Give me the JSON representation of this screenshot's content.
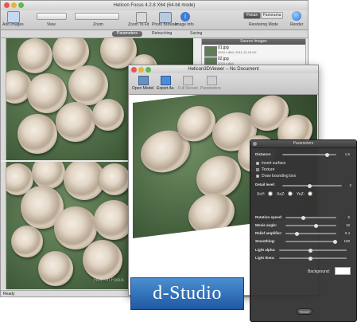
{
  "helicon_focus": {
    "title": "Helicon Focus 4.2.8  X64 (64-bit mode)",
    "toolbar": {
      "add_images": "Add Images",
      "view": "View",
      "zoom": "Zoom",
      "zoom_to_fit": "Zoom To Fit",
      "photo_browser": "Photo Browser",
      "image_info": "Image Info",
      "rendering_mode": "Rendering Mode",
      "render": "Render",
      "mode_focus": "Focus",
      "mode_panorama": "Panorama"
    },
    "tabs": [
      "Parameters",
      "Retouching",
      "Saving"
    ],
    "source_images": {
      "header": "Source Images",
      "items": [
        {
          "name": "01.jpg",
          "info": "2024 x 864, 2011-12-16 09:"
        },
        {
          "name": "02.jpg",
          "info": "2024 x 864"
        }
      ]
    },
    "status": "Ready",
    "watermark": "Helicon Focus"
  },
  "viewer3d": {
    "title": "Helicon3DViewer – No Document",
    "toolbar": [
      "Open Model",
      "Export As",
      "Full Screen",
      "Parameters"
    ]
  },
  "parameters": {
    "title": "Parameters",
    "distance": {
      "label": "Distance:",
      "value": "1.5",
      "level": 0.8
    },
    "checkboxes": [
      {
        "label": "Invert surface",
        "checked": false
      },
      {
        "label": "Texture",
        "checked": true
      },
      {
        "label": "Draw bounding box",
        "checked": false
      }
    ],
    "detail": {
      "label": "Detail level:",
      "value": "2",
      "level": 0.45
    },
    "planes": [
      "XoY:",
      "XoZ:",
      "YoZ:"
    ],
    "sliders": [
      {
        "label": "Rotation speed:",
        "value": "6",
        "level": 0.3
      },
      {
        "label": "Movie angle:",
        "value": "16",
        "level": 0.55
      },
      {
        "label": "Relief amplifier:",
        "value": "0.4",
        "level": 0.2
      },
      {
        "label": "Smoothing:",
        "value": "100",
        "level": 1.0
      },
      {
        "label": "Light alpha:",
        "value": "",
        "level": 0.45
      },
      {
        "label": "Light theta:",
        "value": "",
        "level": 0.45
      }
    ],
    "background_label": "Background:",
    "background_color": "#ffffff",
    "reset": "Reset"
  },
  "logo": {
    "text": "d-Studio"
  }
}
